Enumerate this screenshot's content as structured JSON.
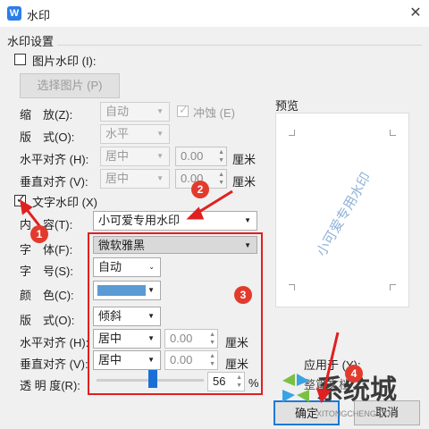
{
  "window": {
    "title": "水印",
    "app_glyph": "W",
    "close_glyph": "✕"
  },
  "group_title": "水印设置",
  "image_watermark": {
    "checkbox_label": "图片水印 (I):",
    "checked": false,
    "select_image_button": "选择图片 (P)",
    "scale_label": "缩　放(Z):",
    "scale_value": "自动",
    "washout_label": "冲蚀 (E)",
    "layout_label": "版　式(O):",
    "layout_value": "水平",
    "h_align_label": "水平对齐 (H):",
    "h_align_value": "居中",
    "h_offset_value": "0.00",
    "h_unit": "厘米",
    "v_align_label": "垂直对齐 (V):",
    "v_align_value": "居中",
    "v_offset_value": "0.00",
    "v_unit": "厘米"
  },
  "text_watermark": {
    "checkbox_label": "文字水印 (X)",
    "checked": true,
    "content_label": "内　容(T):",
    "content_value": "小可爱专用水印",
    "font_label": "字　体(F):",
    "font_value": "微软雅黑",
    "size_label": "字　号(S):",
    "size_value": "自动",
    "color_label": "颜　色(C):",
    "color_value": "#5b9bd5",
    "layout_label": "版　式(O):",
    "layout_value": "倾斜",
    "h_align_label": "水平对齐 (H):",
    "h_align_value": "居中",
    "h_offset_value": "0.00",
    "h_unit": "厘米",
    "v_align_label": "垂直对齐 (V):",
    "v_align_value": "居中",
    "v_offset_value": "0.00",
    "v_unit": "厘米",
    "transparency_label": "透 明 度(R):",
    "transparency_value": "56",
    "transparency_unit": "%"
  },
  "preview": {
    "label": "预览",
    "watermark_text": "小可爱专用水印"
  },
  "apply_to": {
    "label": "应用于 (Y):",
    "value": "整篇文档"
  },
  "buttons": {
    "ok": "确定",
    "cancel": "取消"
  },
  "annotations": [
    "1",
    "2",
    "3",
    "4"
  ],
  "site_logo": {
    "text": "系统城",
    "domain": "XITONGCHENG.COM"
  },
  "colors": {
    "accent": "#1e78d7",
    "annotation_red": "#e02020",
    "font_color_swatch": "#5b9bd5"
  }
}
